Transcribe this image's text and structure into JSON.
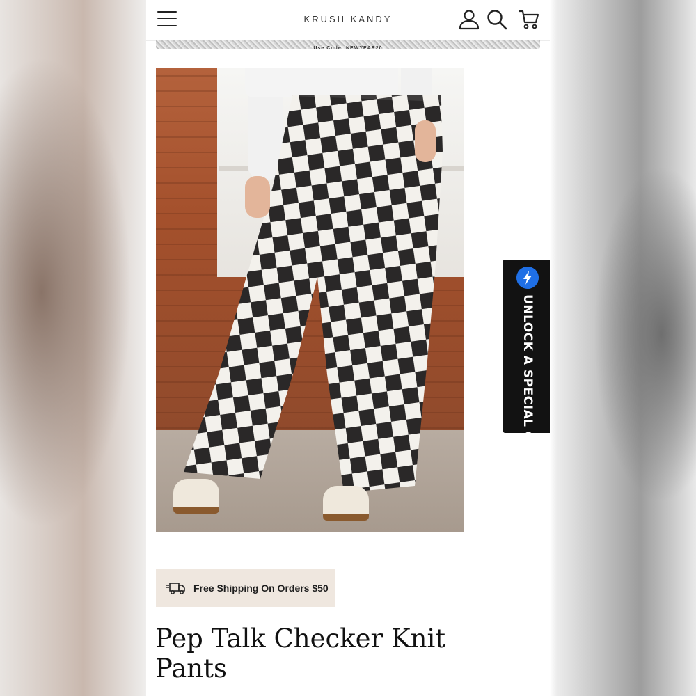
{
  "header": {
    "brand": "KRUSH KANDY",
    "icons": [
      "menu-icon",
      "account-icon",
      "search-icon",
      "cart-icon"
    ]
  },
  "promo_bar": {
    "text": "Use Code: NEWYEAR20"
  },
  "product": {
    "image_alt": "checkered knit pants product photo",
    "shipping_badge": "Free Shipping On Orders $50",
    "title": "Pep Talk Checker Knit Pants"
  },
  "offer_widget": {
    "label": "UNLOCK A SPECIAL OFFER",
    "badge_color": "#1f6fe5"
  },
  "colors": {
    "badge_bg": "#efe7df",
    "widget_bg": "#121212"
  }
}
